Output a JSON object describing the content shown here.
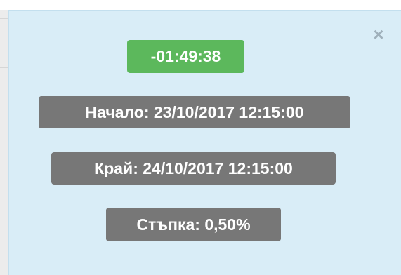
{
  "close": {
    "glyph": "×",
    "icon": "close-icon"
  },
  "timer": {
    "value": "-01:49:38",
    "color": "#5cb85c"
  },
  "start": {
    "label": "Начало: 23/10/2017 12:15:00"
  },
  "end": {
    "label": "Край: 24/10/2017 12:15:00"
  },
  "step": {
    "label": "Стъпка: 0,50%"
  },
  "colors": {
    "panel_background": "#d9edf7",
    "badge_gray": "#777777",
    "badge_green": "#5cb85c",
    "close_icon": "#9fb0bb"
  }
}
